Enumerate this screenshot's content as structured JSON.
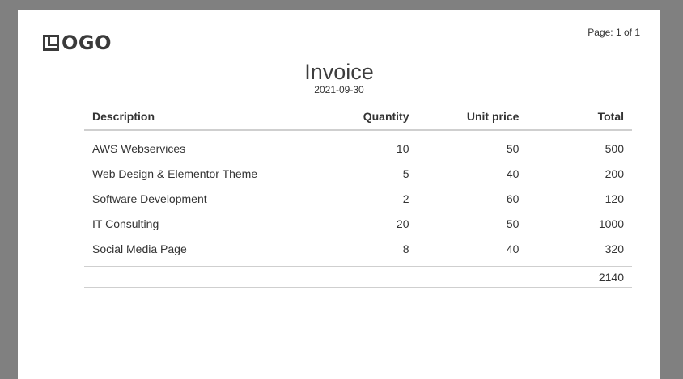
{
  "document": {
    "logo_text": "OGO",
    "page_number": "Page: 1 of 1",
    "title": "Invoice",
    "date": "2021-09-30"
  },
  "table": {
    "headers": {
      "description": "Description",
      "quantity": "Quantity",
      "unit_price": "Unit price",
      "total": "Total"
    },
    "rows": [
      {
        "description": "AWS Webservices",
        "quantity": "10",
        "unit_price": "50",
        "total": "500"
      },
      {
        "description": "Web Design & Elementor Theme",
        "quantity": "5",
        "unit_price": "40",
        "total": "200"
      },
      {
        "description": "Software Development",
        "quantity": "2",
        "unit_price": "60",
        "total": "120"
      },
      {
        "description": "IT Consulting",
        "quantity": "20",
        "unit_price": "50",
        "total": "1000"
      },
      {
        "description": "Social Media Page",
        "quantity": "8",
        "unit_price": "40",
        "total": "320"
      }
    ],
    "grand_total": "2140"
  },
  "colors": {
    "background": "#808080",
    "page": "#ffffff",
    "text": "#3a3a3a",
    "rule": "#cfcfcf"
  }
}
